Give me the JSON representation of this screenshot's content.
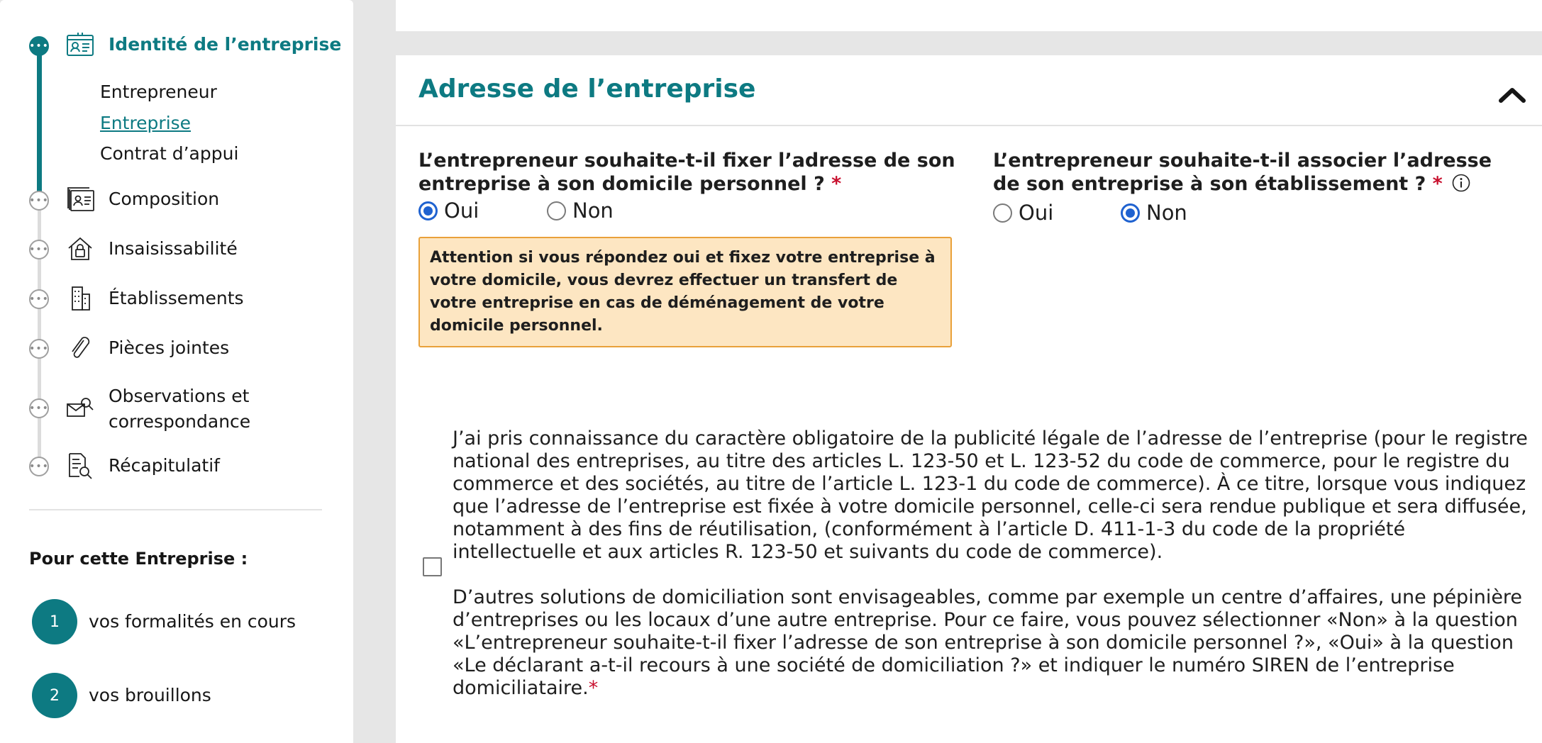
{
  "sidebar": {
    "steps": [
      {
        "label": "Identité de l’entreprise",
        "icon": "id-card-icon"
      },
      {
        "label": "Composition",
        "icon": "people-list-icon"
      },
      {
        "label": "Insaisissabilité",
        "icon": "house-lock-icon"
      },
      {
        "label": "Établissements",
        "icon": "building-icon"
      },
      {
        "label": "Pièces jointes",
        "icon": "paperclip-icon"
      },
      {
        "label": "Observations et correspondance",
        "label_line1": "Observations et",
        "label_line2": "correspondance",
        "icon": "mail-search-icon"
      },
      {
        "label": "Récapitulatif",
        "icon": "document-search-icon"
      }
    ],
    "substeps": [
      "Entrepreneur",
      "Entreprise",
      "Contrat d’appui"
    ],
    "current_substep": "Entreprise",
    "dot_glyph": "•••",
    "formalities_heading": "Pour cette Entreprise :",
    "counters": [
      {
        "count": "1",
        "label": "vos formalités en cours"
      },
      {
        "count": "2",
        "label": "vos brouillons"
      }
    ]
  },
  "section": {
    "title": "Adresse de l’entreprise",
    "collapse_icon": "chevron-up-icon"
  },
  "question1": {
    "label": "L’entrepreneur souhaite-t-il fixer l’adresse de son entreprise à son domicile personnel ?",
    "required_mark": "*",
    "options": [
      "Oui",
      "Non"
    ],
    "selected": "Oui"
  },
  "question2": {
    "label": "L’entrepreneur souhaite-t-il associer l’adresse de son entreprise à son établissement ?",
    "required_mark": "*",
    "options": [
      "Oui",
      "Non"
    ],
    "selected": "Non",
    "info_icon": "info-icon"
  },
  "warning": {
    "text": "Attention si vous répondez oui et fixez votre entreprise à votre domicile, vous devrez effectuer un transfert de votre entreprise en cas de déménagement de votre domicile personnel."
  },
  "legal": {
    "checked": false,
    "paragraph1": "J’ai pris connaissance du caractère obligatoire de la publicité légale de l’adresse de l’entreprise (pour le registre national des entreprises, au titre des articles L. 123-50 et L. 123-52 du code de commerce, pour le registre du commerce et des sociétés, au titre de l’article L. 123-1 du code de commerce). À ce titre, lorsque vous indiquez que l’adresse de l’entreprise est fixée à votre domicile personnel, celle-ci sera rendue publique et sera diffusée, notamment à des fins de réutilisation, (conformément à l’article D. 411-1-3 du code de la propriété intellectuelle et aux articles R. 123-50 et suivants du code de commerce).",
    "paragraph2": "D’autres solutions de domiciliation sont envisageables, comme par exemple un centre d’affaires, une pépinière d’entreprises ou les locaux d’une autre entreprise. Pour ce faire, vous pouvez sélectionner «Non» à la question «L’entrepreneur souhaite-t-il fixer l’adresse de son entreprise à son domicile personnel ?», «Oui» à la question «Le déclarant a-t-il recours à une société de domiciliation ?» et indiquer le numéro SIREN de l’entreprise domiciliataire.",
    "required_mark": "*"
  },
  "colors": {
    "accent": "#0d7a82",
    "radio_selected": "#1f62d0",
    "required": "#c8102e",
    "warning_bg": "#fde6c2",
    "warning_border": "#e9a13a"
  }
}
